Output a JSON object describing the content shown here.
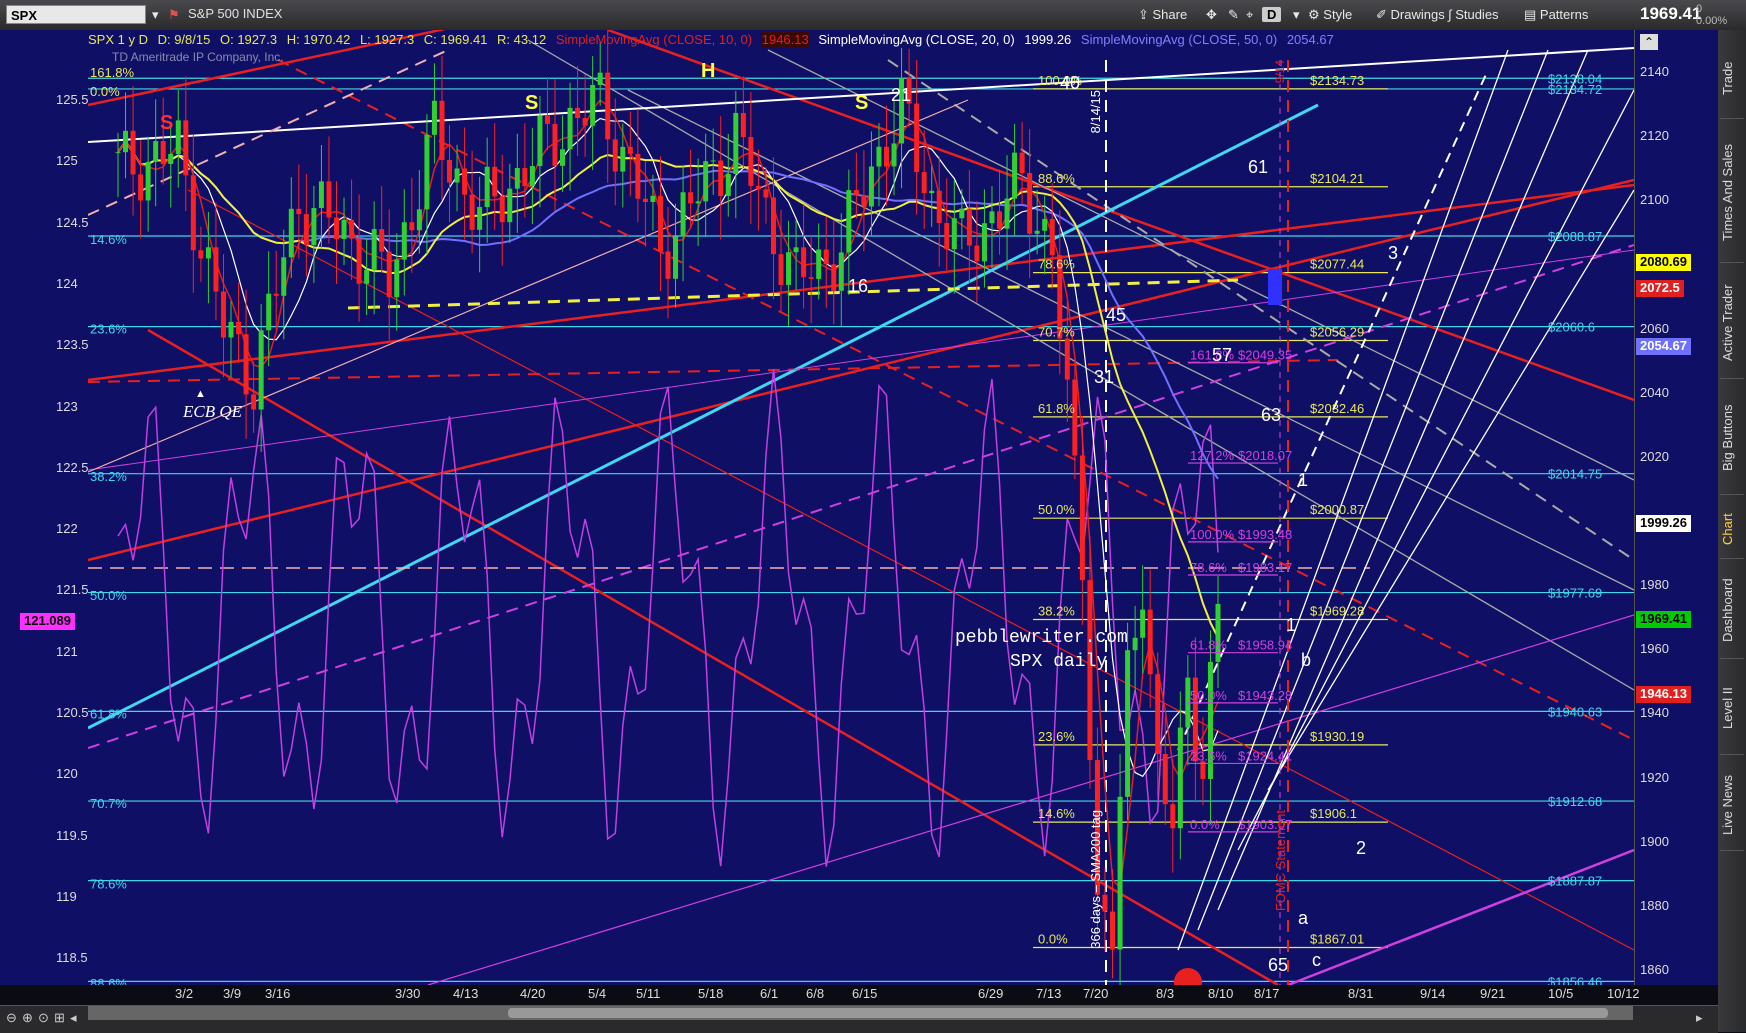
{
  "toolbar": {
    "symbol": "SPX",
    "company": "S&P 500 INDEX",
    "share": "Share",
    "style": "Style",
    "drawings": "Drawings",
    "studies": "Studies",
    "patterns": "Patterns",
    "d_badge": "D",
    "last_price": "1969.41",
    "change_abs": "0",
    "change_pct": "0.00%"
  },
  "infobar": {
    "label": "SPX 1 y D",
    "date": "D: 9/8/15",
    "open": "O: 1927.3",
    "high": "H: 1970.42",
    "low": "L: 1927.3",
    "close": "C: 1969.41",
    "range": "R: 43.12",
    "sma10": "SimpleMovingAvg (CLOSE, 10, 0)",
    "sma10_val": "1946.13",
    "sma20": "SimpleMovingAvg (CLOSE, 20, 0)",
    "sma20_val": "1999.26",
    "sma50": "SimpleMovingAvg (CLOSE, 50, 0)",
    "sma50_val": "2054.67",
    "copyright": "TD Ameritrade IP Company, Inc."
  },
  "left_axis": {
    "ticks": [
      "125.5",
      "125",
      "124.5",
      "124",
      "123.5",
      "123",
      "122.5",
      "122",
      "121.5",
      "121",
      "120.5",
      "120",
      "119.5",
      "119",
      "118.5"
    ],
    "fib_labels": [
      "161.8%",
      "0.0%",
      "14.6%",
      "23.6%",
      "38.2%",
      "50.0%",
      "61.8%",
      "70.7%",
      "78.6%",
      "88.6%"
    ],
    "current": "121.089"
  },
  "right_axis": {
    "ticks": [
      "2140",
      "2120",
      "2100",
      "2080",
      "2060",
      "2040",
      "2020",
      "2000",
      "1980",
      "1960",
      "1940",
      "1920",
      "1900",
      "1880",
      "1860"
    ],
    "badges": [
      {
        "text": "2080.69",
        "bg": "#ffff00",
        "fg": "#000000"
      },
      {
        "text": "2072.5",
        "bg": "#e02020",
        "fg": "#ffffff"
      },
      {
        "text": "2054.67",
        "bg": "#7070ff",
        "fg": "#ffffff"
      },
      {
        "text": "1999.26",
        "bg": "#ffffff",
        "fg": "#000000"
      },
      {
        "text": "1969.41",
        "bg": "#00cc00",
        "fg": "#000000"
      },
      {
        "text": "1946.13",
        "bg": "#e02020",
        "fg": "#ffffff"
      }
    ]
  },
  "x_axis": [
    "3/2",
    "3/9",
    "3/16",
    "3/30",
    "4/13",
    "4/20",
    "5/4",
    "5/11",
    "5/18",
    "6/1",
    "6/8",
    "6/15",
    "6/29",
    "7/13",
    "7/20",
    "8/3",
    "8/10",
    "8/17",
    "8/31",
    "9/14",
    "9/21",
    "10/5",
    "10/12"
  ],
  "fib_levels_yellow": [
    {
      "pct": "100.0%",
      "val": "$2134.73"
    },
    {
      "pct": "88.6%",
      "val": "$2104.21"
    },
    {
      "pct": "78.6%",
      "val": "$2077.44"
    },
    {
      "pct": "70.7%",
      "val": "$2056.29"
    },
    {
      "pct": "61.8%",
      "val": "$2032.46"
    },
    {
      "pct": "50.0%",
      "val": "$2000.87"
    },
    {
      "pct": "38.2%",
      "val": "$1969.28"
    },
    {
      "pct": "23.6%",
      "val": "$1930.19"
    },
    {
      "pct": "14.6%",
      "val": "$1906.1"
    },
    {
      "pct": "0.0%",
      "val": "$1867.01"
    }
  ],
  "fib_levels_cyan": [
    "$2138.04",
    "$2134.72",
    "$2088.87",
    "$2060.6",
    "$2014.75",
    "$1977.69",
    "$1940.63",
    "$1912.68",
    "$1887.87",
    "$1856.46"
  ],
  "fib_levels_magenta": [
    {
      "pct": "161.8%",
      "val": "$2049.35"
    },
    {
      "pct": "127.2%",
      "val": "$2018.07"
    },
    {
      "pct": "100.0%",
      "val": "$1993.48"
    },
    {
      "pct": "78.6%",
      "val": "$1983.17"
    },
    {
      "pct": "61.8%",
      "val": "$1958.94"
    },
    {
      "pct": "50.0%",
      "val": "$1943.28"
    },
    {
      "pct": "23.6%",
      "val": "$1924.41"
    },
    {
      "pct": "0.0%",
      "val": "$1903.07"
    }
  ],
  "annotations": {
    "watermark1": "pebblewriter.com",
    "watermark2": "SPX daily",
    "ecb": "ECB QE",
    "vertical1": "8/14/15",
    "vertical2": "366 days – SMA200 tag",
    "vertical3": "FOMC Statement",
    "vertical4": "9/14",
    "hs": [
      "S",
      "H",
      "S",
      "S"
    ],
    "numbers": [
      "21",
      "40",
      "61",
      "16",
      "45",
      "57",
      "31",
      "63",
      "65",
      "3",
      "1",
      "2"
    ],
    "waves": [
      "a",
      "b",
      "c"
    ]
  },
  "sidebar_tabs": [
    "Trade",
    "Times And Sales",
    "Active Trader",
    "Big Buttons",
    "Chart",
    "Dashboard",
    "Level II",
    "Live News"
  ],
  "colors": {
    "background": "#0f0f66",
    "accent": "#ff3030",
    "fib": "#e8e85a",
    "cyan": "#40d8e8",
    "magenta": "#d040e0"
  }
}
